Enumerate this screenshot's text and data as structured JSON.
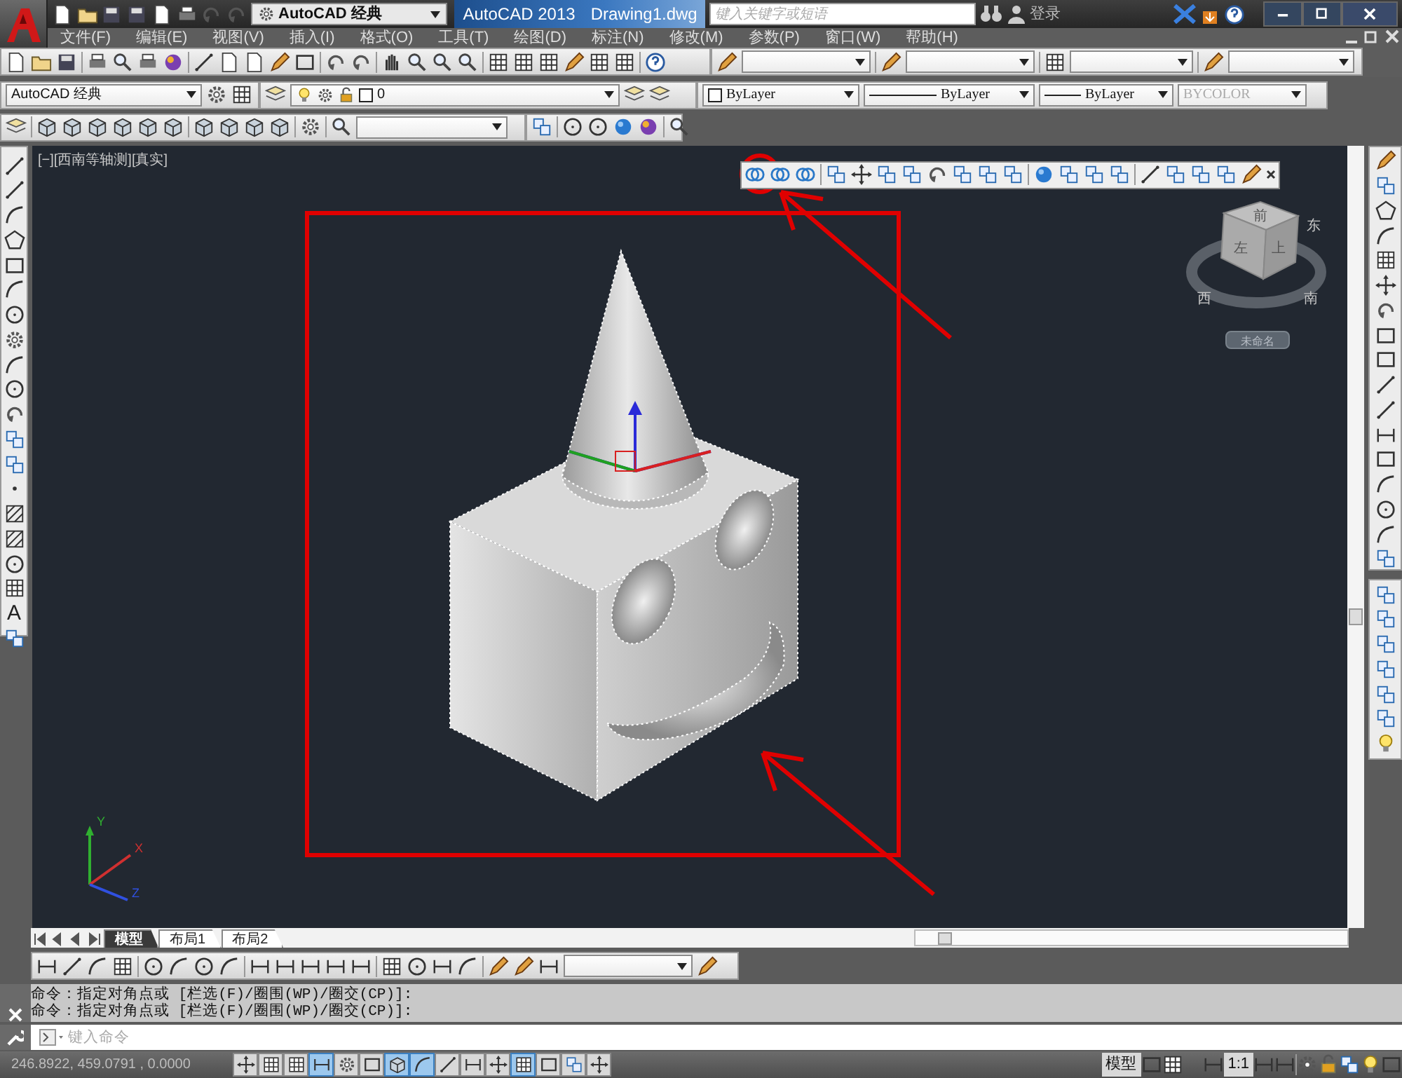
{
  "title_bar": {
    "workspace": "AutoCAD 经典",
    "product": "AutoCAD 2013",
    "file": "Drawing1.dwg",
    "search": {
      "placeholder": "键入关键字或短语"
    },
    "login": "登录"
  },
  "menu": [
    "文件(F)",
    "编辑(E)",
    "视图(V)",
    "插入(I)",
    "格式(O)",
    "工具(T)",
    "绘图(D)",
    "标注(N)",
    "修改(M)",
    "参数(P)",
    "窗口(W)",
    "帮助(H)"
  ],
  "draw_toolbar": {
    "text_tool": "A"
  },
  "properties_toolbar": {
    "workspace": "AutoCAD 经典",
    "layer": "0",
    "color_setting": "ByLayer",
    "linetype": "ByLayer",
    "lineweight": "ByLayer",
    "plot_style": {
      "value": "BYCOLOR",
      "disabled": true
    }
  },
  "viewport": {
    "label": "[−][西南等轴测][真实]",
    "viewcube": {
      "faces": [
        "前",
        "左",
        "上"
      ],
      "compass": [
        "东",
        "西",
        "南"
      ],
      "view_name": "未命名"
    },
    "ucs": [
      "X",
      "Y",
      "Z"
    ]
  },
  "layout_tabs": [
    {
      "label": "模型",
      "selected": true
    },
    {
      "label": "布局1",
      "selected": false
    },
    {
      "label": "布局2",
      "selected": false
    }
  ],
  "command_history": [
    "命令：指定对角点或 [栏选(F)/圈围(WP)/圈交(CP)]:",
    "命令：指定对角点或 [栏选(F)/圈围(WP)/圈交(CP)]:"
  ],
  "command_line": {
    "placeholder": "键入命令"
  },
  "status_bar": {
    "coordinates": "246.8922, 459.0791 , 0.0000",
    "toggles": [
      {
        "on": false
      },
      {
        "on": false
      },
      {
        "on": false
      },
      {
        "on": true
      },
      {
        "on": false
      },
      {
        "on": false
      },
      {
        "on": true
      },
      {
        "on": true
      },
      {
        "on": false
      },
      {
        "on": false
      },
      {
        "on": false
      },
      {
        "on": true
      },
      {
        "on": false
      },
      {
        "on": false
      },
      {
        "on": false
      }
    ],
    "space": "模型",
    "scale": "1:1"
  }
}
